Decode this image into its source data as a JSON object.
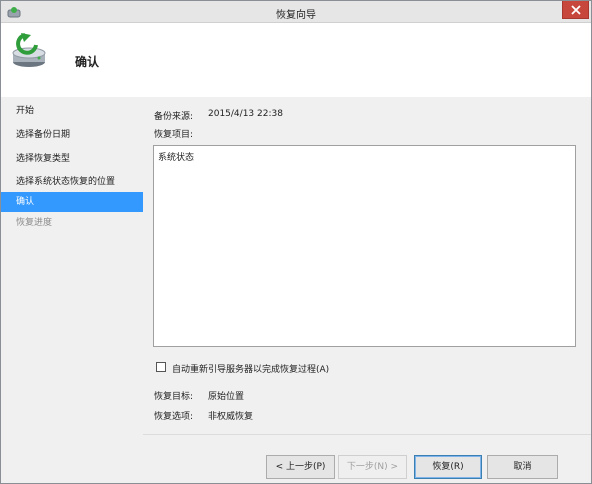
{
  "window": {
    "title": "恢复向导"
  },
  "header": {
    "title": "确认"
  },
  "sidebar": {
    "items": [
      {
        "label": "开始",
        "state": "normal"
      },
      {
        "label": "选择备份日期",
        "state": "normal"
      },
      {
        "label": "选择恢复类型",
        "state": "normal"
      },
      {
        "label": "选择系统状态恢复的位置",
        "state": "normal"
      },
      {
        "label": "确认",
        "state": "active"
      },
      {
        "label": "恢复进度",
        "state": "disabled"
      }
    ]
  },
  "main": {
    "backup_source_label": "备份来源:",
    "backup_source_value": "2015/4/13 22:38",
    "restore_items_label": "恢复项目:",
    "restore_items": [
      "系统状态"
    ],
    "auto_restart_label": "自动重新引导服务器以完成恢复过程(A)",
    "auto_restart_checked": false,
    "target_label": "恢复目标:",
    "target_value": "原始位置",
    "options_label": "恢复选项:",
    "options_value": "非权威恢复"
  },
  "buttons": {
    "back": "< 上一步(P)",
    "next": "下一步(N) >",
    "restore": "恢复(R)",
    "cancel": "取消"
  },
  "colors": {
    "accent": "#3399ff",
    "close": "#c7473c"
  }
}
